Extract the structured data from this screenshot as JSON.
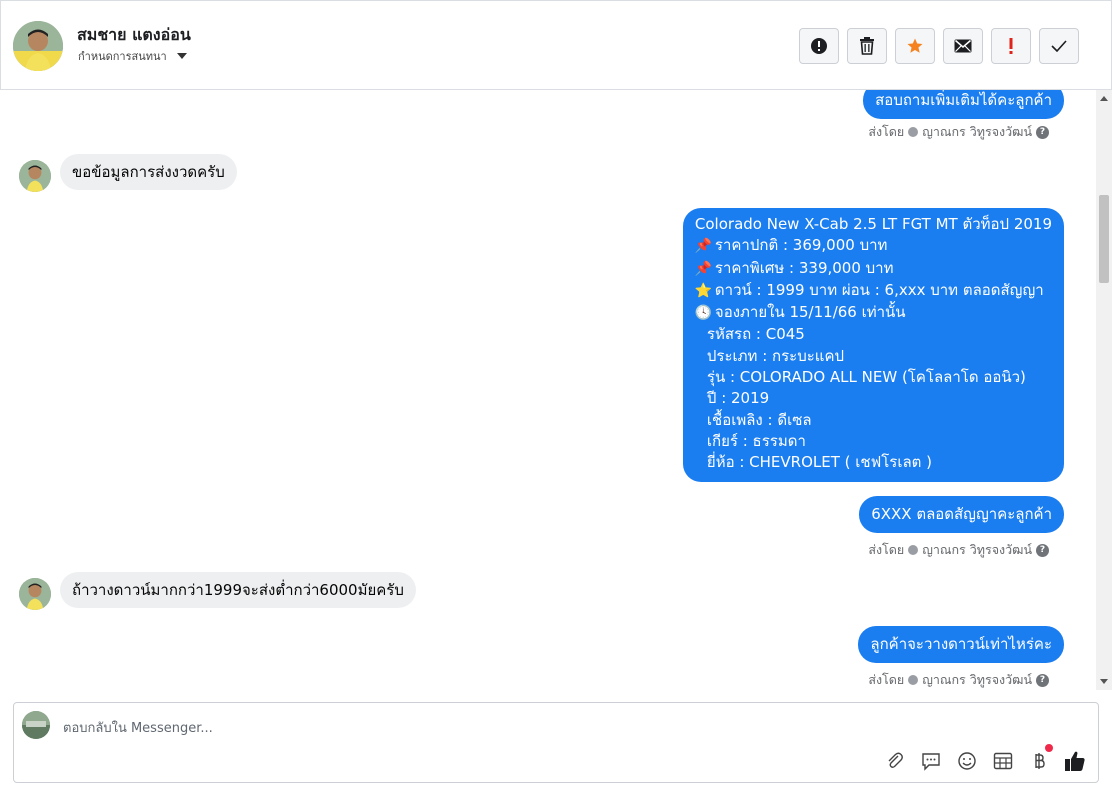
{
  "header": {
    "contact_name": "สมชาย แตงอ่อน",
    "assign_label": "กำหนดการสนทนา",
    "actions": [
      {
        "name": "report-spam-button",
        "icon": "exclamation-circle-icon"
      },
      {
        "name": "delete-button",
        "icon": "trash-icon"
      },
      {
        "name": "star-button",
        "icon": "star-icon"
      },
      {
        "name": "mark-unread-button",
        "icon": "envelope-icon"
      },
      {
        "name": "follow-up-button",
        "icon": "exclamation-mark-icon"
      },
      {
        "name": "mark-done-button",
        "icon": "checkmark-icon"
      }
    ]
  },
  "messages": {
    "m1": "สอบถามเพิ่มเติมได้คะลูกค้า",
    "sent_by_1": {
      "prefix": "ส่งโดย",
      "agent": "ญาณกร วิทูรจงวัฒน์"
    },
    "m2": "ขอข้อมูลการส่งงวดครับ",
    "m3": {
      "lines": [
        {
          "emoji": "",
          "text": "Colorado New X-Cab 2.5 LT FGT MT ตัวท็อป 2019"
        },
        {
          "emoji": "📌",
          "text": "ราคาปกติ : 369,000 บาท"
        },
        {
          "emoji": "📌",
          "text": "ราคาพิเศษ : 339,000 บาท"
        },
        {
          "emoji": "⭐",
          "text": "ดาวน์ : 1999 บาท ผ่อน : 6,xxx บาท ตลอดสัญญา"
        },
        {
          "emoji": "🕓",
          "text": "จองภายใน 15/11/66 เท่านั้น"
        },
        {
          "emoji": "",
          "text": "รหัสรถ : C045"
        },
        {
          "emoji": "",
          "text": "ประเภท : กระบะแคป"
        },
        {
          "emoji": "",
          "text": "รุ่น : COLORADO ALL NEW (โคโลลาโด ออนิว)"
        },
        {
          "emoji": "",
          "text": "ปี : 2019"
        },
        {
          "emoji": "",
          "text": "เชื้อเพลิง : ดีเซล"
        },
        {
          "emoji": "",
          "text": "เกียร์ : ธรรมดา"
        },
        {
          "emoji": "",
          "text": "ยี่ห้อ : CHEVROLET ( เชฟโรเลต )"
        }
      ]
    },
    "m4": "6XXX ตลอดสัญญาคะลูกค้า",
    "sent_by_2": {
      "prefix": "ส่งโดย",
      "agent": "ญาณกร วิทูรจงวัฒน์"
    },
    "m5": "ถ้าวางดาวน์มากกว่า1999จะส่งต่ำกว่า6000มัยครับ",
    "m6": "ลูกค้าจะวางดาวน์เท่าไหร่คะ",
    "sent_by_3": {
      "prefix": "ส่งโดย",
      "agent": "ญาณกร วิทูรจงวัฒน์"
    }
  },
  "composer": {
    "placeholder": "ตอบกลับใน Messenger...",
    "tools": [
      "paperclip-icon",
      "saved-replies-icon",
      "emoji-icon",
      "table-icon",
      "baht-icon",
      "thumbs-up-icon"
    ]
  },
  "colors": {
    "outgoing_bubble": "#1b7ef0",
    "incoming_bubble": "#eeeff1",
    "star": "#f5821f",
    "follow_up": "#e0241b"
  }
}
